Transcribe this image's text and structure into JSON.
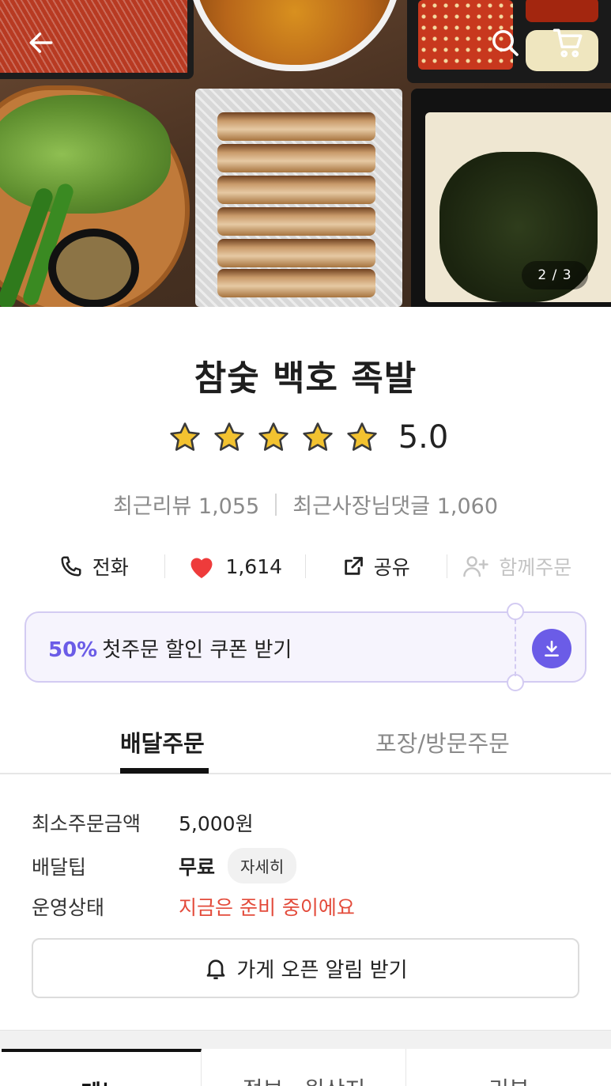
{
  "hero": {
    "page_indicator": "2 / 3"
  },
  "store": {
    "name": "참숯 백호 족발",
    "rating": "5.0",
    "stars": 5,
    "recent_reviews_label": "최근리뷰 1,055",
    "owner_replies_label": "최근사장님댓글 1,060"
  },
  "actions": {
    "call": "전화",
    "likes": "1,614",
    "share": "공유",
    "group_order": "함께주문"
  },
  "coupon": {
    "percent": "50%",
    "text": "첫주문 할인 쿠폰 받기"
  },
  "order_tabs": {
    "delivery": "배달주문",
    "pickup": "포장/방문주문"
  },
  "delivery_info": {
    "min_order_label": "최소주문금액",
    "min_order_value": "5,000원",
    "tip_label": "배달팁",
    "tip_value": "무료",
    "detail_button": "자세히",
    "status_label": "운영상태",
    "status_value": "지금은 준비 중이에요",
    "notify_button": "가게 오픈 알림 받기"
  },
  "bottom_tabs": {
    "menu": "메뉴",
    "info": "정보 · 원산지",
    "review": "리뷰"
  },
  "colors": {
    "accent_purple": "#6b5ce7",
    "status_red": "#e34b3b",
    "heart_red": "#ee3b3b",
    "star_gold": "#f2c230"
  },
  "icons": [
    "back-arrow-icon",
    "search-icon",
    "cart-icon",
    "phone-icon",
    "heart-icon",
    "share-icon",
    "add-person-icon",
    "download-icon",
    "bell-icon",
    "star-icon"
  ]
}
